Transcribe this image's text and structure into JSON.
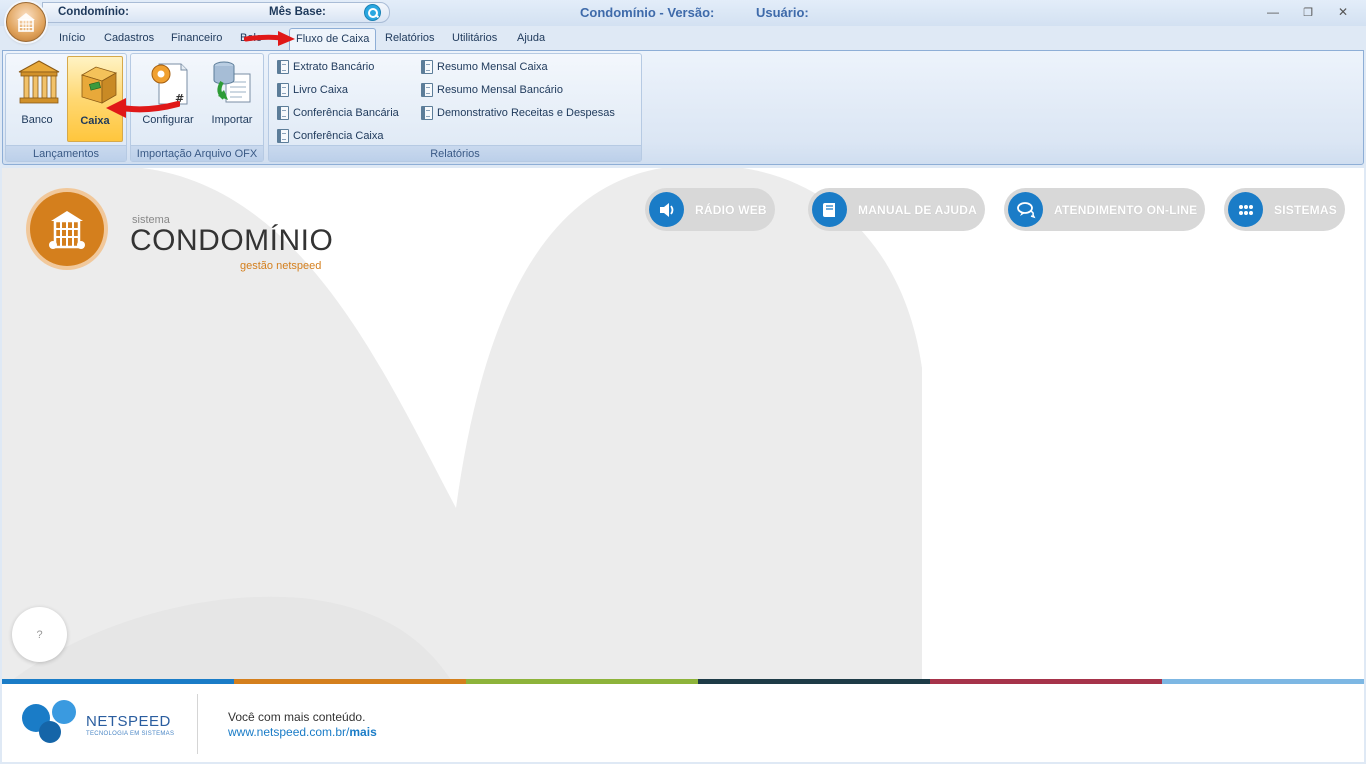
{
  "titlebar": {
    "condominio_label": "Condomínio:",
    "mes_base_label": "Mês Base:",
    "app_title": "Condomínio - Versão:",
    "usuario_label": "Usuário:",
    "minimize_glyph": "—",
    "restore_glyph": "❐",
    "close_glyph": "✕"
  },
  "menu": {
    "tabs": [
      {
        "label": "Início"
      },
      {
        "label": "Cadastros"
      },
      {
        "label": "Financeiro"
      },
      {
        "label": "Bole"
      },
      {
        "label": "Fluxo de Caixa",
        "active": true
      },
      {
        "label": "Relatórios"
      },
      {
        "label": "Utilitários"
      },
      {
        "label": "Ajuda"
      }
    ]
  },
  "ribbon": {
    "groups": {
      "lancamentos": {
        "label": "Lançamentos",
        "buttons": [
          {
            "label": "Banco",
            "icon": "bank-icon"
          },
          {
            "label": "Caixa",
            "icon": "cash-box-icon",
            "selected": true
          }
        ]
      },
      "importacao": {
        "label": "Importação Arquivo OFX",
        "buttons": [
          {
            "label": "Configurar",
            "icon": "gear-document-icon"
          },
          {
            "label": "Importar",
            "icon": "database-import-icon"
          }
        ]
      },
      "relatorios": {
        "label": "Relatórios",
        "items": [
          "Extrato Bancário",
          "Livro Caixa",
          "Conferência Bancária",
          "Conferência Caixa",
          "Resumo Mensal Caixa",
          "Resumo Mensal Bancário",
          "Demonstrativo Receitas e Despesas"
        ]
      }
    }
  },
  "content": {
    "logo": {
      "sistema": "sistema",
      "title": "CONDOMÍNIO",
      "subtitle": "gestão netspeed"
    },
    "pills": [
      {
        "label": "RÁDIO WEB",
        "icon": "speaker-icon"
      },
      {
        "label": "MANUAL DE AJUDA",
        "icon": "book-icon"
      },
      {
        "label": "ATENDIMENTO ON-LINE",
        "icon": "chat-icon"
      },
      {
        "label": "SISTEMAS",
        "icon": "grid-dots-icon"
      }
    ],
    "help_button": "?",
    "stripe_colors": [
      "#1a7cc7",
      "#d47f1d",
      "#8db33a",
      "#1e3b47",
      "#a6334a",
      "#7db7e3"
    ]
  },
  "footer": {
    "brand": "NETSPEED",
    "tagline": "TECNOLOGIA EM SISTEMAS",
    "text1": "Você com mais conteúdo.",
    "link_prefix": "www.netspeed.com.br/",
    "link_bold": "mais"
  },
  "colors": {
    "accent_blue": "#1a7cc7",
    "accent_orange": "#d47f1d",
    "annotation_red": "#e01818"
  }
}
